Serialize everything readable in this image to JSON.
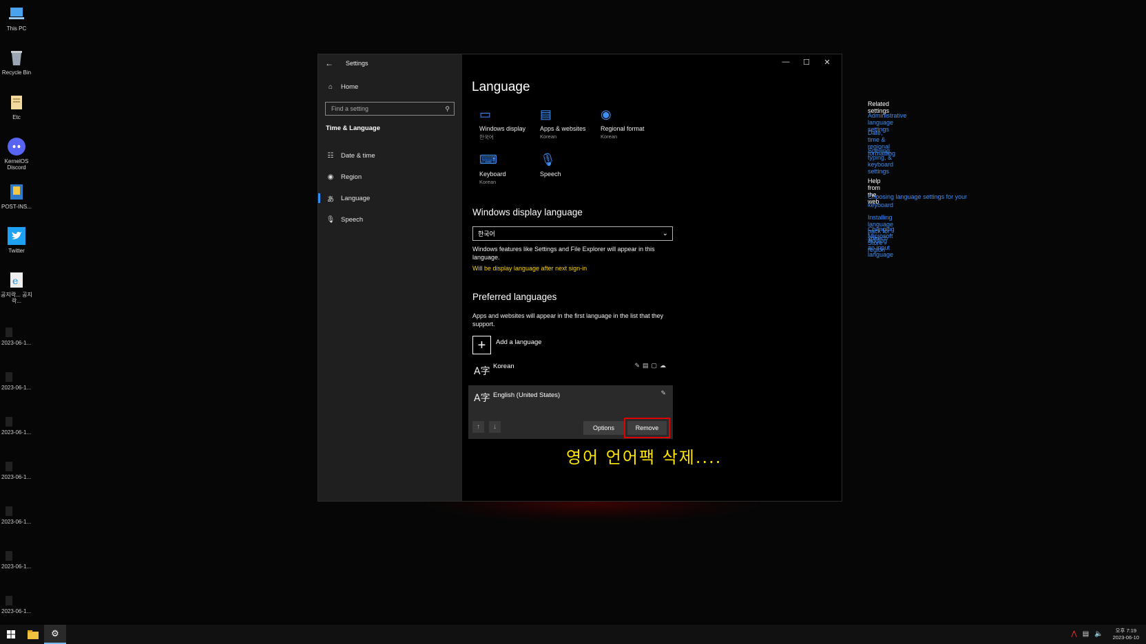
{
  "desktop": {
    "icons": [
      {
        "label": "This PC",
        "icon": "computer-icon"
      },
      {
        "label": "Recycle Bin",
        "icon": "recycle-bin-icon"
      },
      {
        "label": "Etc",
        "icon": "folder-icon"
      },
      {
        "label": "KernelOS Discord",
        "icon": "discord-icon"
      },
      {
        "label": "POST-INS...",
        "icon": "installer-icon"
      },
      {
        "label": "Twitter",
        "icon": "twitter-icon"
      },
      {
        "label": "공지락... 공지락...",
        "icon": "internet-explorer-icon"
      }
    ],
    "dated_files": [
      "2023-06-1...",
      "2023-06-1...",
      "2023-06-1...",
      "2023-06-1...",
      "2023-06-1...",
      "2023-06-1...",
      "2023-06-1..."
    ]
  },
  "window": {
    "app_title": "Settings",
    "home": "Home",
    "search_placeholder": "Find a setting",
    "section": "Time & Language",
    "nav": [
      {
        "label": "Date & time",
        "icon": "calendar-clock-icon"
      },
      {
        "label": "Region",
        "icon": "globe-icon"
      },
      {
        "label": "Language",
        "icon": "language-icon",
        "active": true
      },
      {
        "label": "Speech",
        "icon": "microphone-icon"
      }
    ]
  },
  "page": {
    "title": "Language",
    "tiles": [
      {
        "label": "Windows display",
        "sub": "한국어",
        "icon": "monitor-icon"
      },
      {
        "label": "Apps & websites",
        "sub": "Korean",
        "icon": "browser-window-icon"
      },
      {
        "label": "Regional format",
        "sub": "Korean",
        "icon": "regional-format-icon"
      },
      {
        "label": "Keyboard",
        "sub": "Korean",
        "icon": "keyboard-icon"
      },
      {
        "label": "Speech",
        "sub": "",
        "icon": "microphone-icon"
      }
    ],
    "display_language": {
      "heading": "Windows display language",
      "selected": "한국어",
      "description": "Windows features like Settings and File Explorer will appear in this language.",
      "notice": "Will be display language after next sign-in"
    },
    "preferred": {
      "heading": "Preferred languages",
      "description": "Apps and websites will appear in the first language in the list that they support.",
      "add_label": "Add a language",
      "languages": [
        {
          "name": "Korean"
        },
        {
          "name": "English (United States)"
        }
      ],
      "options_label": "Options",
      "remove_label": "Remove"
    },
    "related": {
      "heading": "Related settings",
      "links": [
        "Administrative language settings",
        "Date, time & regional formatting",
        "Spelling, typing, & keyboard settings"
      ]
    },
    "help": {
      "heading": "Help from the web",
      "links": [
        "Choosing language settings for your keyboard",
        "Installing language pack for speech",
        "Changing Microsoft Store region",
        "Adding an input language"
      ]
    }
  },
  "overlay_caption": "영어 언어팩 삭제....",
  "colors": {
    "accent": "#3d8ef5",
    "highlight": "#e00000",
    "caption": "#ffe600",
    "notice": "#ffd500"
  },
  "taskbar": {
    "clock_time": "오후 7:19",
    "clock_date": "2023-06-10"
  }
}
